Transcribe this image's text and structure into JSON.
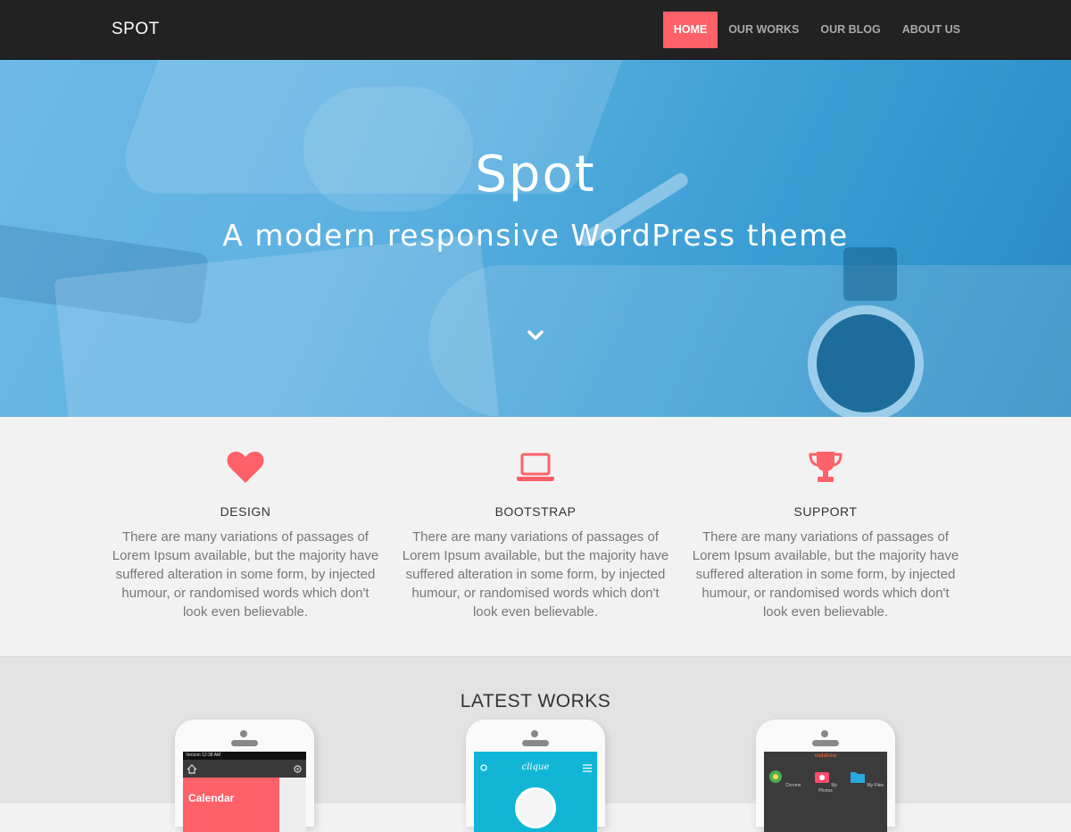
{
  "nav": {
    "brand": "SPOT",
    "items": [
      {
        "label": "HOME",
        "active": true
      },
      {
        "label": "OUR WORKS",
        "active": false
      },
      {
        "label": "OUR BLOG",
        "active": false
      },
      {
        "label": "ABOUT US",
        "active": false
      }
    ]
  },
  "hero": {
    "title": "Spot",
    "subtitle": "A modern responsive WordPress theme",
    "scroll_icon": "chevron-down-icon"
  },
  "features": [
    {
      "icon": "heart-icon",
      "title": "DESIGN",
      "text": "There are many variations of passages of Lorem Ipsum available, but the majority have suffered alteration in some form, by injected humour, or randomised words which don't look even believable."
    },
    {
      "icon": "laptop-icon",
      "title": "BOOTSTRAP",
      "text": "There are many variations of passages of Lorem Ipsum available, but the majority have suffered alteration in some form, by injected humour, or randomised words which don't look even believable."
    },
    {
      "icon": "trophy-icon",
      "title": "SUPPORT",
      "text": "There are many variations of passages of Lorem Ipsum available, but the majority have suffered alteration in some form, by injected humour, or randomised words which don't look even believable."
    }
  ],
  "works": {
    "title": "LATEST WORKS",
    "items": [
      {
        "status_bar": "Verizon  12:38 AM",
        "label": "Calendar"
      },
      {
        "label": "clique"
      },
      {
        "carrier": "vodafone",
        "apps": [
          "Chrome",
          "My Photos",
          "My Files"
        ]
      }
    ]
  },
  "colors": {
    "accent": "#ff6169",
    "navbar": "#222222",
    "hero_overlay": "#6cbde8"
  }
}
